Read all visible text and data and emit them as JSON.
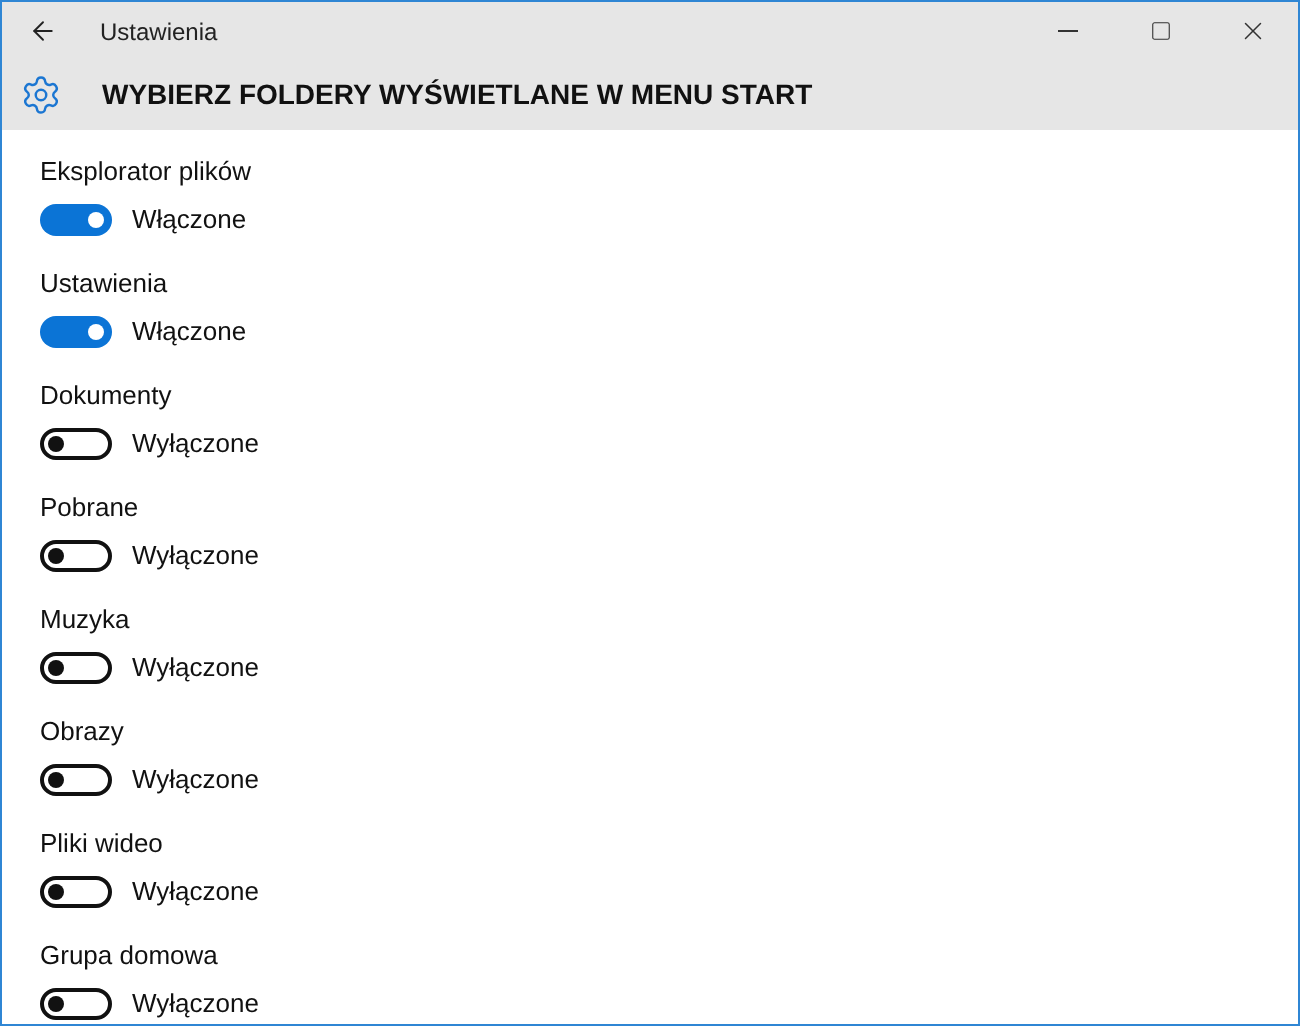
{
  "window": {
    "title": "Ustawienia"
  },
  "page_title": "WYBIERZ FOLDERY WYŚWIETLANE W MENU START",
  "settings": [
    {
      "label": "Eksplorator plików",
      "on": true,
      "state_text": "Włączone"
    },
    {
      "label": "Ustawienia",
      "on": true,
      "state_text": "Włączone"
    },
    {
      "label": "Dokumenty",
      "on": false,
      "state_text": "Wyłączone"
    },
    {
      "label": "Pobrane",
      "on": false,
      "state_text": "Wyłączone"
    },
    {
      "label": "Muzyka",
      "on": false,
      "state_text": "Wyłączone"
    },
    {
      "label": "Obrazy",
      "on": false,
      "state_text": "Wyłączone"
    },
    {
      "label": "Pliki wideo",
      "on": false,
      "state_text": "Wyłączone"
    },
    {
      "label": "Grupa domowa",
      "on": false,
      "state_text": "Wyłączone"
    }
  ]
}
